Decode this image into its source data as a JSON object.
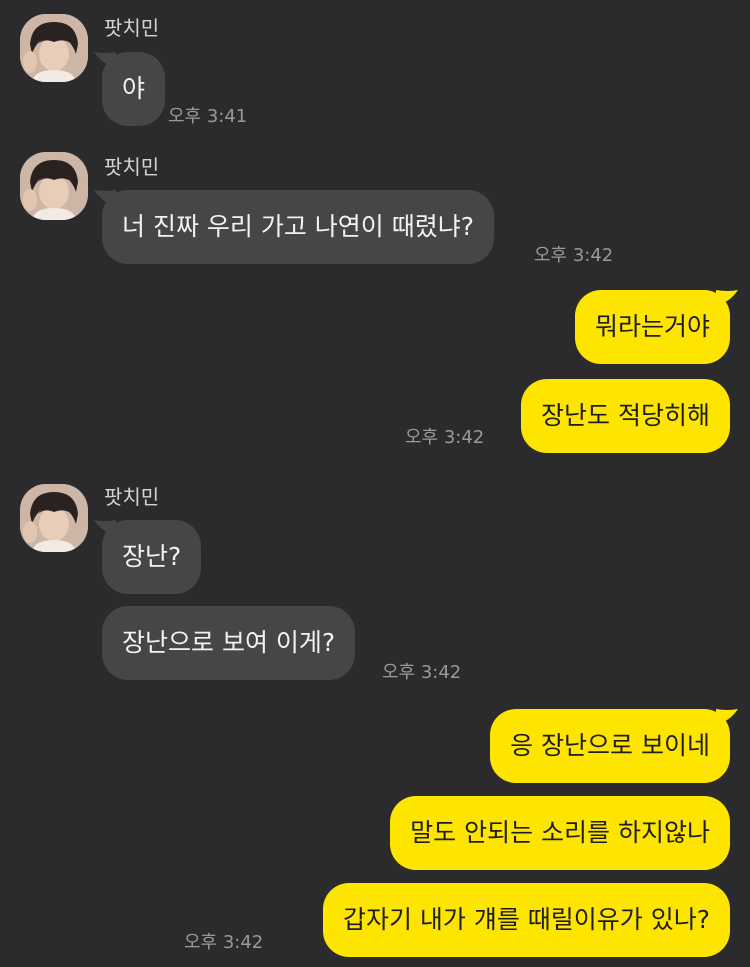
{
  "chat": {
    "sender_name": "팟치민",
    "messages": {
      "m1": "야",
      "m2": "너 진짜 우리 가고 나연이 때렸냐?",
      "m3": "뭐라는거야",
      "m4": "장난도 적당히해",
      "m5": "장난?",
      "m6": "장난으로 보여 이게?",
      "m7": "응 장난으로 보이네",
      "m8": "말도 안되는 소리를 하지않나",
      "m9": "갑자기 내가 걔를 때릴이유가 있나?"
    },
    "times": {
      "t1": "오후 3:41",
      "t2": "오후 3:42",
      "t3": "오후 3:42",
      "t4": "오후 3:42",
      "t5": "오후 3:42"
    }
  },
  "colors": {
    "background": "#2b2b2d",
    "incoming_bubble": "#464649",
    "outgoing_bubble": "#fee500",
    "timestamp": "#9a9a9d"
  }
}
